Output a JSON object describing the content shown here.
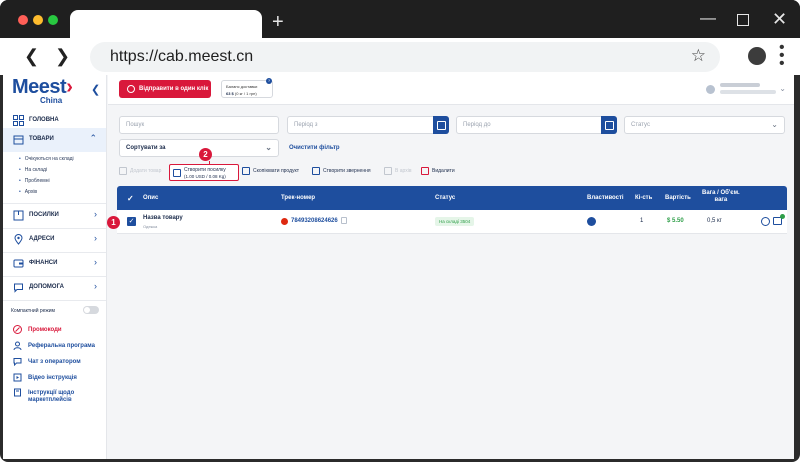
{
  "browser": {
    "url": "https://cab.meest.cn"
  },
  "logo": {
    "main": "Meest",
    "sub": "China"
  },
  "sidebar": {
    "items": [
      {
        "label": "ГОЛОВНА"
      },
      {
        "label": "ТОВАРИ"
      },
      {
        "label": "ПОСИЛКИ"
      },
      {
        "label": "АДРЕСИ"
      },
      {
        "label": "ФІНАНСИ"
      },
      {
        "label": "ДОПОМОГА"
      }
    ],
    "goods_sub": [
      "Очікуються на складі",
      "На складі",
      "Проблемні",
      "Архів"
    ],
    "compact_mode": "Компактний режим",
    "links": [
      {
        "label": "Промокоди"
      },
      {
        "label": "Реферальна програма"
      },
      {
        "label": "Чат з оператором"
      },
      {
        "label": "Відео інструкція"
      },
      {
        "label": "Інструкції щодо",
        "label2": "маркетплейсів"
      }
    ]
  },
  "header": {
    "send_button": "Відправити в один клік",
    "balance_label": "Баланс доставки",
    "balance_value": "63 $",
    "balance_note": "(0 кг / 1 грн)",
    "help": "?"
  },
  "filters": {
    "search_placeholder": "Пошук",
    "period_from": "Період з",
    "period_to": "Період до",
    "status": "Статус",
    "sort": "Сортувати за",
    "clear": "Очистити фільтр"
  },
  "actions": {
    "add_goods": "Додати товар",
    "create_package_l1": "Створити посилку",
    "create_package_l2": "(1.00 USD / 0.08 Kg)",
    "copy_product": "Скопіювати продукт",
    "create_request": "Створити звернення",
    "to_archive": "В архів",
    "delete": "Видалити"
  },
  "callouts": {
    "one": "1",
    "two": "2"
  },
  "table": {
    "headers": {
      "description": "Опис",
      "track": "Трек-номер",
      "status": "Статус",
      "properties": "Властивості",
      "qty": "Кі-сть",
      "price": "Вартість",
      "weight_l1": "Вага / Об'єм.",
      "weight_l2": "вага"
    },
    "rows": [
      {
        "name": "Назва товару",
        "subtitle": "Одежка",
        "track": "78493208624626",
        "status": "На складі 3504",
        "qty": "1",
        "price": "$ 5.50",
        "weight": "0,5 кг"
      }
    ]
  },
  "colors": {
    "brand": "#1e4e9e",
    "accent": "#d9183b",
    "success": "#2e9e48"
  }
}
